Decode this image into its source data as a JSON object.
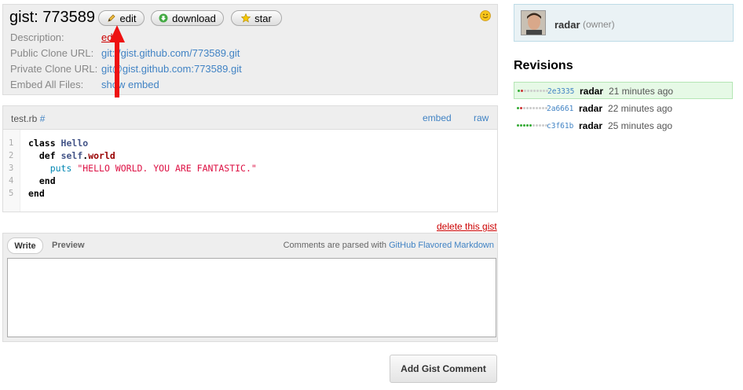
{
  "header": {
    "title": "gist: 773589",
    "edit_label": "edit",
    "download_label": "download",
    "star_label": "star"
  },
  "meta": {
    "description_label": "Description:",
    "description_value": "edit",
    "public_label": "Public Clone URL:",
    "public_value": "git://gist.github.com/773589.git",
    "private_label": "Private Clone URL:",
    "private_value": "git@gist.github.com:773589.git",
    "embed_label": "Embed All Files:",
    "embed_value": "show embed"
  },
  "file": {
    "name": "test.rb",
    "hash": "#",
    "embed_label": "embed",
    "raw_label": "raw",
    "lines": [
      {
        "no": "1",
        "parts": [
          [
            "kw",
            "class "
          ],
          [
            "cls",
            "Hello"
          ]
        ]
      },
      {
        "no": "2",
        "parts": [
          [
            "sp",
            "  "
          ],
          [
            "kw",
            "def "
          ],
          [
            "selfc",
            "self"
          ],
          [
            "kw",
            "."
          ],
          [
            "meth",
            "world"
          ]
        ]
      },
      {
        "no": "3",
        "parts": [
          [
            "sp",
            "    "
          ],
          [
            "putsc",
            "puts "
          ],
          [
            "str",
            "\"HELLO WORLD. YOU ARE FANTASTIC.\""
          ]
        ]
      },
      {
        "no": "4",
        "parts": [
          [
            "sp",
            "  "
          ],
          [
            "kw",
            "end"
          ]
        ]
      },
      {
        "no": "5",
        "parts": [
          [
            "kw",
            "end"
          ]
        ]
      }
    ]
  },
  "delete_link": "delete this gist",
  "comment": {
    "write_tab": "Write",
    "preview_tab": "Preview",
    "note_prefix": "Comments are parsed with ",
    "note_link": "GitHub Flavored Markdown",
    "textarea_value": ""
  },
  "add_button": "Add Gist Comment",
  "owner": {
    "name": "radar",
    "role": "(owner)"
  },
  "revisions": {
    "title": "Revisions",
    "items": [
      {
        "hash": "2e3335",
        "user": "radar",
        "time": "21 minutes ago",
        "active": true,
        "dots": [
          "g",
          "r",
          "n",
          "n",
          "n",
          "n",
          "n",
          "n",
          "n",
          "n"
        ]
      },
      {
        "hash": "2a6661",
        "user": "radar",
        "time": "22 minutes ago",
        "active": false,
        "dots": [
          "g",
          "r",
          "n",
          "n",
          "n",
          "n",
          "n",
          "n",
          "n",
          "n"
        ]
      },
      {
        "hash": "c3f61b",
        "user": "radar",
        "time": "25 minutes ago",
        "active": false,
        "dots": [
          "g",
          "g",
          "g",
          "g",
          "g",
          "n",
          "n",
          "n",
          "n",
          "n"
        ]
      }
    ]
  },
  "colors": {
    "link": "#4183c4",
    "danger": "#cc0000",
    "arrow": "#ee1111",
    "active_revision": "#e6f9e6"
  },
  "icons": {
    "edit": "pencil-icon",
    "download": "download-arrow-icon",
    "star": "star-icon",
    "smiley": "smiley-icon"
  }
}
